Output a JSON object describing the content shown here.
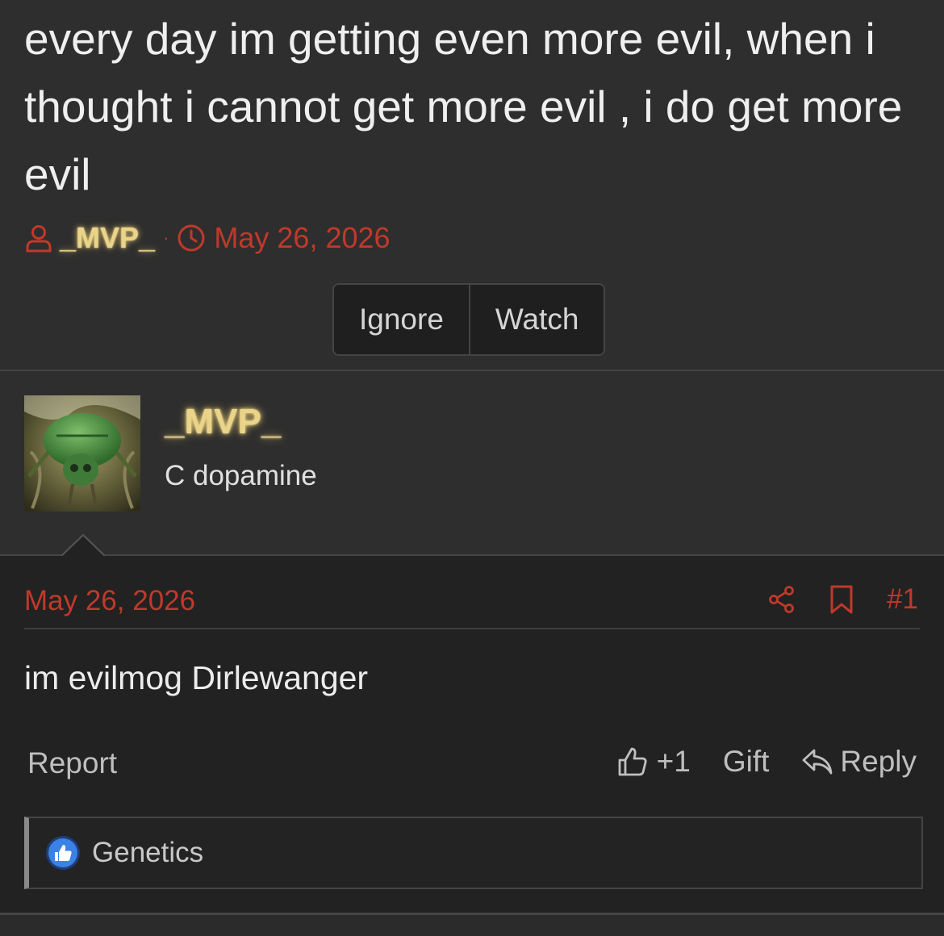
{
  "thread": {
    "title": "every day im getting even more evil, when i thought i cannot get more evil , i do get more evil",
    "author": "_MVP_",
    "separator": "·",
    "date": "May 26, 2026",
    "buttons": {
      "ignore": "Ignore",
      "watch": "Watch"
    }
  },
  "post": {
    "username": "_MVP_",
    "user_title": "C dopamine",
    "date": "May 26, 2026",
    "number": "#1",
    "content": "im evilmog Dirlewanger",
    "report": "Report",
    "like_count": "+1",
    "gift": "Gift",
    "reply": "Reply",
    "reactions_label": "Genetics"
  },
  "icons": [
    "user-icon",
    "clock-icon",
    "share-icon",
    "bookmark-icon",
    "thumbs-up-icon",
    "reply-icon",
    "like-badge-icon"
  ],
  "colors": {
    "accent": "#c0392b",
    "username_glow": "#e9d48a",
    "background": "#2b2b2b",
    "post_background": "#222222"
  }
}
